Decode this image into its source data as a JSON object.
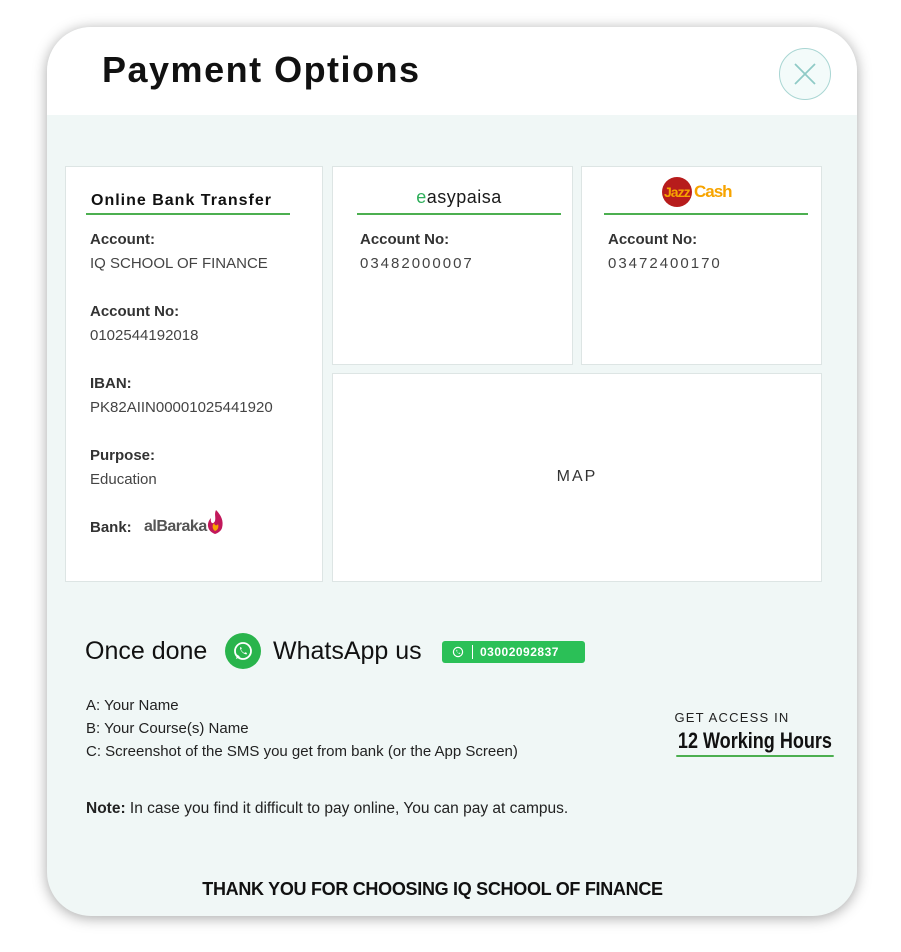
{
  "modal": {
    "title": "Payment Options",
    "close_icon": "close-icon"
  },
  "bank_transfer": {
    "heading": "Online Bank Transfer",
    "account_label": "Account:",
    "account_value": "IQ SCHOOL OF FINANCE",
    "account_no_label": "Account No:",
    "account_no_value": "0102544192018",
    "iban_label": "IBAN:",
    "iban_value": "PK82AIIN00001025441920",
    "purpose_label": "Purpose:",
    "purpose_value": "Education",
    "bank_label": "Bank:",
    "bank_logo_text": "alBaraka"
  },
  "easypaisa": {
    "logo_text": "easypaisa",
    "account_no_label": "Account No:",
    "account_no_value": "03482000007"
  },
  "jazzcash": {
    "logo_text_jazz": "Jazz",
    "logo_text_cash": "Cash",
    "account_no_label": "Account No:",
    "account_no_value": "03472400170"
  },
  "map": {
    "label": "MAP"
  },
  "whatsapp": {
    "once_done": "Once done",
    "whatsapp_us": "WhatsApp us",
    "number": "03002092837",
    "icon": "whatsapp-icon"
  },
  "instructions": [
    "A: Your Name",
    "B: Your Course(s) Name",
    "C: Screenshot of the SMS you get from bank (or the App Screen)"
  ],
  "access": {
    "caption": "GET ACCESS IN",
    "hours": "12 Working Hours"
  },
  "note": {
    "label": "Note:",
    "text": " In case you find it difficult to pay online, You can pay at campus."
  },
  "footer": {
    "thanks": "THANK YOU FOR CHOOSING IQ SCHOOL OF FINANCE"
  },
  "colors": {
    "accent_green": "#4caf50",
    "whatsapp_green": "#29b44c",
    "modal_bg": "#f0f7f6",
    "close_border": "#a9d6d3",
    "albaraka_red": "#c2185b",
    "jazz_orange": "#f7a400"
  }
}
